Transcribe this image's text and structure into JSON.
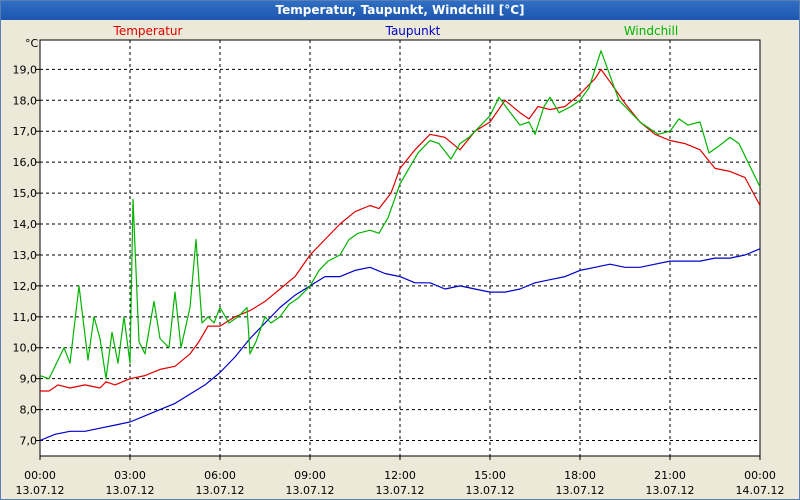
{
  "window": {
    "title": "Temperatur, Taupunkt, Windchill [°C]"
  },
  "chart_data": {
    "type": "line",
    "title": "Temperatur, Taupunkt, Windchill [°C]",
    "ylabel": "°C",
    "ylim": [
      6.5,
      19.95
    ],
    "xlim": [
      "13.07.12 00:00",
      "14.07.12 00:00"
    ],
    "grid": true,
    "legend_position": "top",
    "y_ticks": [
      "7,0",
      "8,0",
      "9,0",
      "10,0",
      "11,0",
      "12,0",
      "13,0",
      "14,0",
      "15,0",
      "16,0",
      "17,0",
      "18,0",
      "19,0"
    ],
    "x_ticks": [
      {
        "time": "00:00",
        "date": "13.07.12"
      },
      {
        "time": "03:00",
        "date": "13.07.12"
      },
      {
        "time": "06:00",
        "date": "13.07.12"
      },
      {
        "time": "09:00",
        "date": "13.07.12"
      },
      {
        "time": "12:00",
        "date": "13.07.12"
      },
      {
        "time": "15:00",
        "date": "13.07.12"
      },
      {
        "time": "18:00",
        "date": "13.07.12"
      },
      {
        "time": "21:00",
        "date": "13.07.12"
      },
      {
        "time": "00:00",
        "date": "14.07.12"
      }
    ],
    "x_unit": "hours since 13.07.12 00:00",
    "series": [
      {
        "name": "Temperatur",
        "color": "#e00000",
        "points": [
          [
            0,
            8.6
          ],
          [
            0.3,
            8.6
          ],
          [
            0.6,
            8.8
          ],
          [
            1,
            8.7
          ],
          [
            1.5,
            8.8
          ],
          [
            2,
            8.7
          ],
          [
            2.2,
            8.9
          ],
          [
            2.5,
            8.8
          ],
          [
            3,
            9.0
          ],
          [
            3.5,
            9.1
          ],
          [
            4,
            9.3
          ],
          [
            4.5,
            9.4
          ],
          [
            5,
            9.8
          ],
          [
            5.3,
            10.2
          ],
          [
            5.6,
            10.7
          ],
          [
            6,
            10.7
          ],
          [
            6.5,
            11.0
          ],
          [
            7,
            11.2
          ],
          [
            7.5,
            11.5
          ],
          [
            8,
            11.9
          ],
          [
            8.5,
            12.3
          ],
          [
            9,
            13.0
          ],
          [
            9.5,
            13.5
          ],
          [
            10,
            14.0
          ],
          [
            10.5,
            14.4
          ],
          [
            11,
            14.6
          ],
          [
            11.3,
            14.5
          ],
          [
            11.7,
            15.0
          ],
          [
            12,
            15.8
          ],
          [
            12.5,
            16.4
          ],
          [
            13,
            16.9
          ],
          [
            13.5,
            16.8
          ],
          [
            14,
            16.4
          ],
          [
            14.5,
            17.0
          ],
          [
            15,
            17.3
          ],
          [
            15.5,
            18.0
          ],
          [
            16,
            17.6
          ],
          [
            16.3,
            17.4
          ],
          [
            16.6,
            17.8
          ],
          [
            17,
            17.7
          ],
          [
            17.5,
            17.8
          ],
          [
            18,
            18.2
          ],
          [
            18.5,
            18.7
          ],
          [
            18.7,
            19.0
          ],
          [
            19,
            18.6
          ],
          [
            19.5,
            17.9
          ],
          [
            20,
            17.3
          ],
          [
            20.5,
            16.9
          ],
          [
            21,
            16.7
          ],
          [
            21.5,
            16.6
          ],
          [
            22,
            16.4
          ],
          [
            22.5,
            15.8
          ],
          [
            23,
            15.7
          ],
          [
            23.5,
            15.5
          ],
          [
            24,
            14.6
          ]
        ]
      },
      {
        "name": "Taupunkt",
        "color": "#0000c8",
        "points": [
          [
            0,
            7.0
          ],
          [
            0.5,
            7.2
          ],
          [
            1,
            7.3
          ],
          [
            1.5,
            7.3
          ],
          [
            2,
            7.4
          ],
          [
            2.5,
            7.5
          ],
          [
            3,
            7.6
          ],
          [
            3.5,
            7.8
          ],
          [
            4,
            8.0
          ],
          [
            4.5,
            8.2
          ],
          [
            5,
            8.5
          ],
          [
            5.5,
            8.8
          ],
          [
            6,
            9.2
          ],
          [
            6.5,
            9.7
          ],
          [
            7,
            10.3
          ],
          [
            7.5,
            10.8
          ],
          [
            8,
            11.3
          ],
          [
            8.5,
            11.7
          ],
          [
            9,
            12.0
          ],
          [
            9.5,
            12.3
          ],
          [
            10,
            12.3
          ],
          [
            10.5,
            12.5
          ],
          [
            11,
            12.6
          ],
          [
            11.5,
            12.4
          ],
          [
            12,
            12.3
          ],
          [
            12.5,
            12.1
          ],
          [
            13,
            12.1
          ],
          [
            13.5,
            11.9
          ],
          [
            14,
            12.0
          ],
          [
            14.5,
            11.9
          ],
          [
            15,
            11.8
          ],
          [
            15.5,
            11.8
          ],
          [
            16,
            11.9
          ],
          [
            16.5,
            12.1
          ],
          [
            17,
            12.2
          ],
          [
            17.5,
            12.3
          ],
          [
            18,
            12.5
          ],
          [
            18.5,
            12.6
          ],
          [
            19,
            12.7
          ],
          [
            19.5,
            12.6
          ],
          [
            20,
            12.6
          ],
          [
            20.5,
            12.7
          ],
          [
            21,
            12.8
          ],
          [
            21.5,
            12.8
          ],
          [
            22,
            12.8
          ],
          [
            22.5,
            12.9
          ],
          [
            23,
            12.9
          ],
          [
            23.5,
            13.0
          ],
          [
            24,
            13.2
          ]
        ]
      },
      {
        "name": "Windchill",
        "color": "#00b400",
        "points": [
          [
            0,
            9.1
          ],
          [
            0.3,
            9.0
          ],
          [
            0.6,
            9.6
          ],
          [
            0.8,
            10.0
          ],
          [
            1,
            9.5
          ],
          [
            1.3,
            12.0
          ],
          [
            1.6,
            9.6
          ],
          [
            1.8,
            11.0
          ],
          [
            2,
            10.3
          ],
          [
            2.2,
            9.0
          ],
          [
            2.4,
            10.5
          ],
          [
            2.6,
            9.5
          ],
          [
            2.8,
            11.0
          ],
          [
            3,
            9.5
          ],
          [
            3.1,
            14.8
          ],
          [
            3.3,
            10.2
          ],
          [
            3.5,
            9.8
          ],
          [
            3.8,
            11.5
          ],
          [
            4,
            10.3
          ],
          [
            4.3,
            10.0
          ],
          [
            4.5,
            11.8
          ],
          [
            4.7,
            10.0
          ],
          [
            5,
            11.3
          ],
          [
            5.2,
            13.5
          ],
          [
            5.4,
            10.8
          ],
          [
            5.6,
            11.0
          ],
          [
            5.8,
            10.8
          ],
          [
            6,
            11.3
          ],
          [
            6.3,
            10.8
          ],
          [
            6.6,
            11.0
          ],
          [
            6.9,
            11.3
          ],
          [
            7,
            9.8
          ],
          [
            7.2,
            10.2
          ],
          [
            7.5,
            11.0
          ],
          [
            7.7,
            10.8
          ],
          [
            8,
            11.0
          ],
          [
            8.3,
            11.4
          ],
          [
            8.6,
            11.6
          ],
          [
            9,
            12.0
          ],
          [
            9.3,
            12.5
          ],
          [
            9.6,
            12.8
          ],
          [
            10,
            13.0
          ],
          [
            10.3,
            13.5
          ],
          [
            10.6,
            13.7
          ],
          [
            11,
            13.8
          ],
          [
            11.3,
            13.7
          ],
          [
            11.6,
            14.2
          ],
          [
            12,
            15.3
          ],
          [
            12.3,
            15.8
          ],
          [
            12.6,
            16.3
          ],
          [
            13,
            16.7
          ],
          [
            13.3,
            16.6
          ],
          [
            13.7,
            16.1
          ],
          [
            14,
            16.6
          ],
          [
            14.3,
            16.8
          ],
          [
            14.7,
            17.2
          ],
          [
            15,
            17.5
          ],
          [
            15.3,
            18.1
          ],
          [
            15.6,
            17.7
          ],
          [
            16,
            17.2
          ],
          [
            16.3,
            17.3
          ],
          [
            16.5,
            16.9
          ],
          [
            16.8,
            17.8
          ],
          [
            17,
            18.1
          ],
          [
            17.3,
            17.6
          ],
          [
            17.7,
            17.8
          ],
          [
            18,
            18.0
          ],
          [
            18.3,
            18.4
          ],
          [
            18.5,
            19.0
          ],
          [
            18.7,
            19.6
          ],
          [
            19,
            18.8
          ],
          [
            19.3,
            18.0
          ],
          [
            19.6,
            17.7
          ],
          [
            20,
            17.3
          ],
          [
            20.3,
            17.1
          ],
          [
            20.6,
            16.9
          ],
          [
            21,
            17.0
          ],
          [
            21.3,
            17.4
          ],
          [
            21.6,
            17.2
          ],
          [
            22,
            17.3
          ],
          [
            22.3,
            16.3
          ],
          [
            22.6,
            16.5
          ],
          [
            23,
            16.8
          ],
          [
            23.3,
            16.6
          ],
          [
            23.6,
            16.0
          ],
          [
            24,
            15.2
          ]
        ]
      }
    ]
  }
}
